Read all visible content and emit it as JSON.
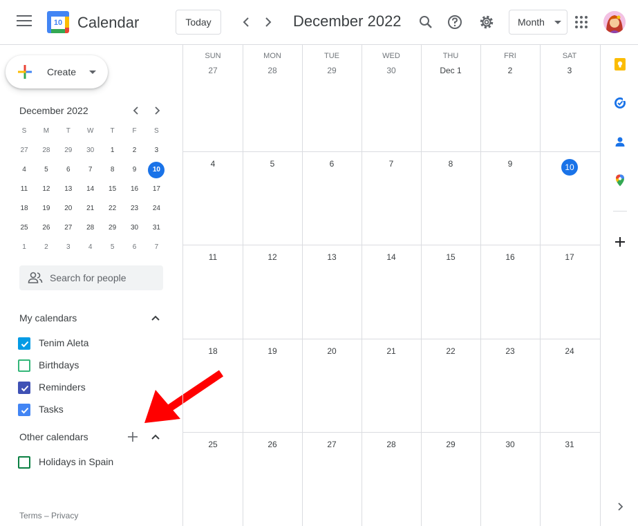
{
  "header": {
    "app_title": "Calendar",
    "logo_day": "10",
    "today_label": "Today",
    "prev_label": "‹",
    "next_label": "›",
    "month_title": "December 2022",
    "view_select": "Month"
  },
  "sidebar": {
    "create_label": "Create",
    "mini_calendar": {
      "title": "December 2022",
      "weekdays": [
        "S",
        "M",
        "T",
        "W",
        "T",
        "F",
        "S"
      ],
      "weeks": [
        [
          "27",
          "28",
          "29",
          "30",
          "1",
          "2",
          "3"
        ],
        [
          "4",
          "5",
          "6",
          "7",
          "8",
          "9",
          "10"
        ],
        [
          "11",
          "12",
          "13",
          "14",
          "15",
          "16",
          "17"
        ],
        [
          "18",
          "19",
          "20",
          "21",
          "22",
          "23",
          "24"
        ],
        [
          "25",
          "26",
          "27",
          "28",
          "29",
          "30",
          "31"
        ],
        [
          "1",
          "2",
          "3",
          "4",
          "5",
          "6",
          "7"
        ]
      ]
    },
    "search_people_placeholder": "Search for people",
    "my_calendars_title": "My calendars",
    "my_calendars": [
      {
        "label": "Tenim Aleta",
        "checked": true,
        "color": "#039be5"
      },
      {
        "label": "Birthdays",
        "checked": false,
        "color": "#33b679"
      },
      {
        "label": "Reminders",
        "checked": true,
        "color": "#3f51b5"
      },
      {
        "label": "Tasks",
        "checked": true,
        "color": "#4285f4"
      }
    ],
    "other_calendars_title": "Other calendars",
    "other_calendars": [
      {
        "label": "Holidays in Spain",
        "checked": false,
        "color": "#0b8043"
      }
    ],
    "footer": "Terms – Privacy"
  },
  "grid": {
    "weekdays": [
      "SUN",
      "MON",
      "TUE",
      "WED",
      "THU",
      "FRI",
      "SAT"
    ],
    "weeks": [
      [
        "27",
        "28",
        "29",
        "30",
        "Dec 1",
        "2",
        "3"
      ],
      [
        "4",
        "5",
        "6",
        "7",
        "8",
        "9",
        "10"
      ],
      [
        "11",
        "12",
        "13",
        "14",
        "15",
        "16",
        "17"
      ],
      [
        "18",
        "19",
        "20",
        "21",
        "22",
        "23",
        "24"
      ],
      [
        "25",
        "26",
        "27",
        "28",
        "29",
        "30",
        "31"
      ]
    ],
    "today": "10"
  },
  "rail": {
    "icons": [
      "keep-icon",
      "tasks-icon",
      "contacts-icon",
      "maps-icon",
      "add-addon-icon",
      "expand-panel-icon"
    ]
  },
  "colors": {
    "accent": "#1a73e8",
    "annotation": "#ff0000"
  }
}
